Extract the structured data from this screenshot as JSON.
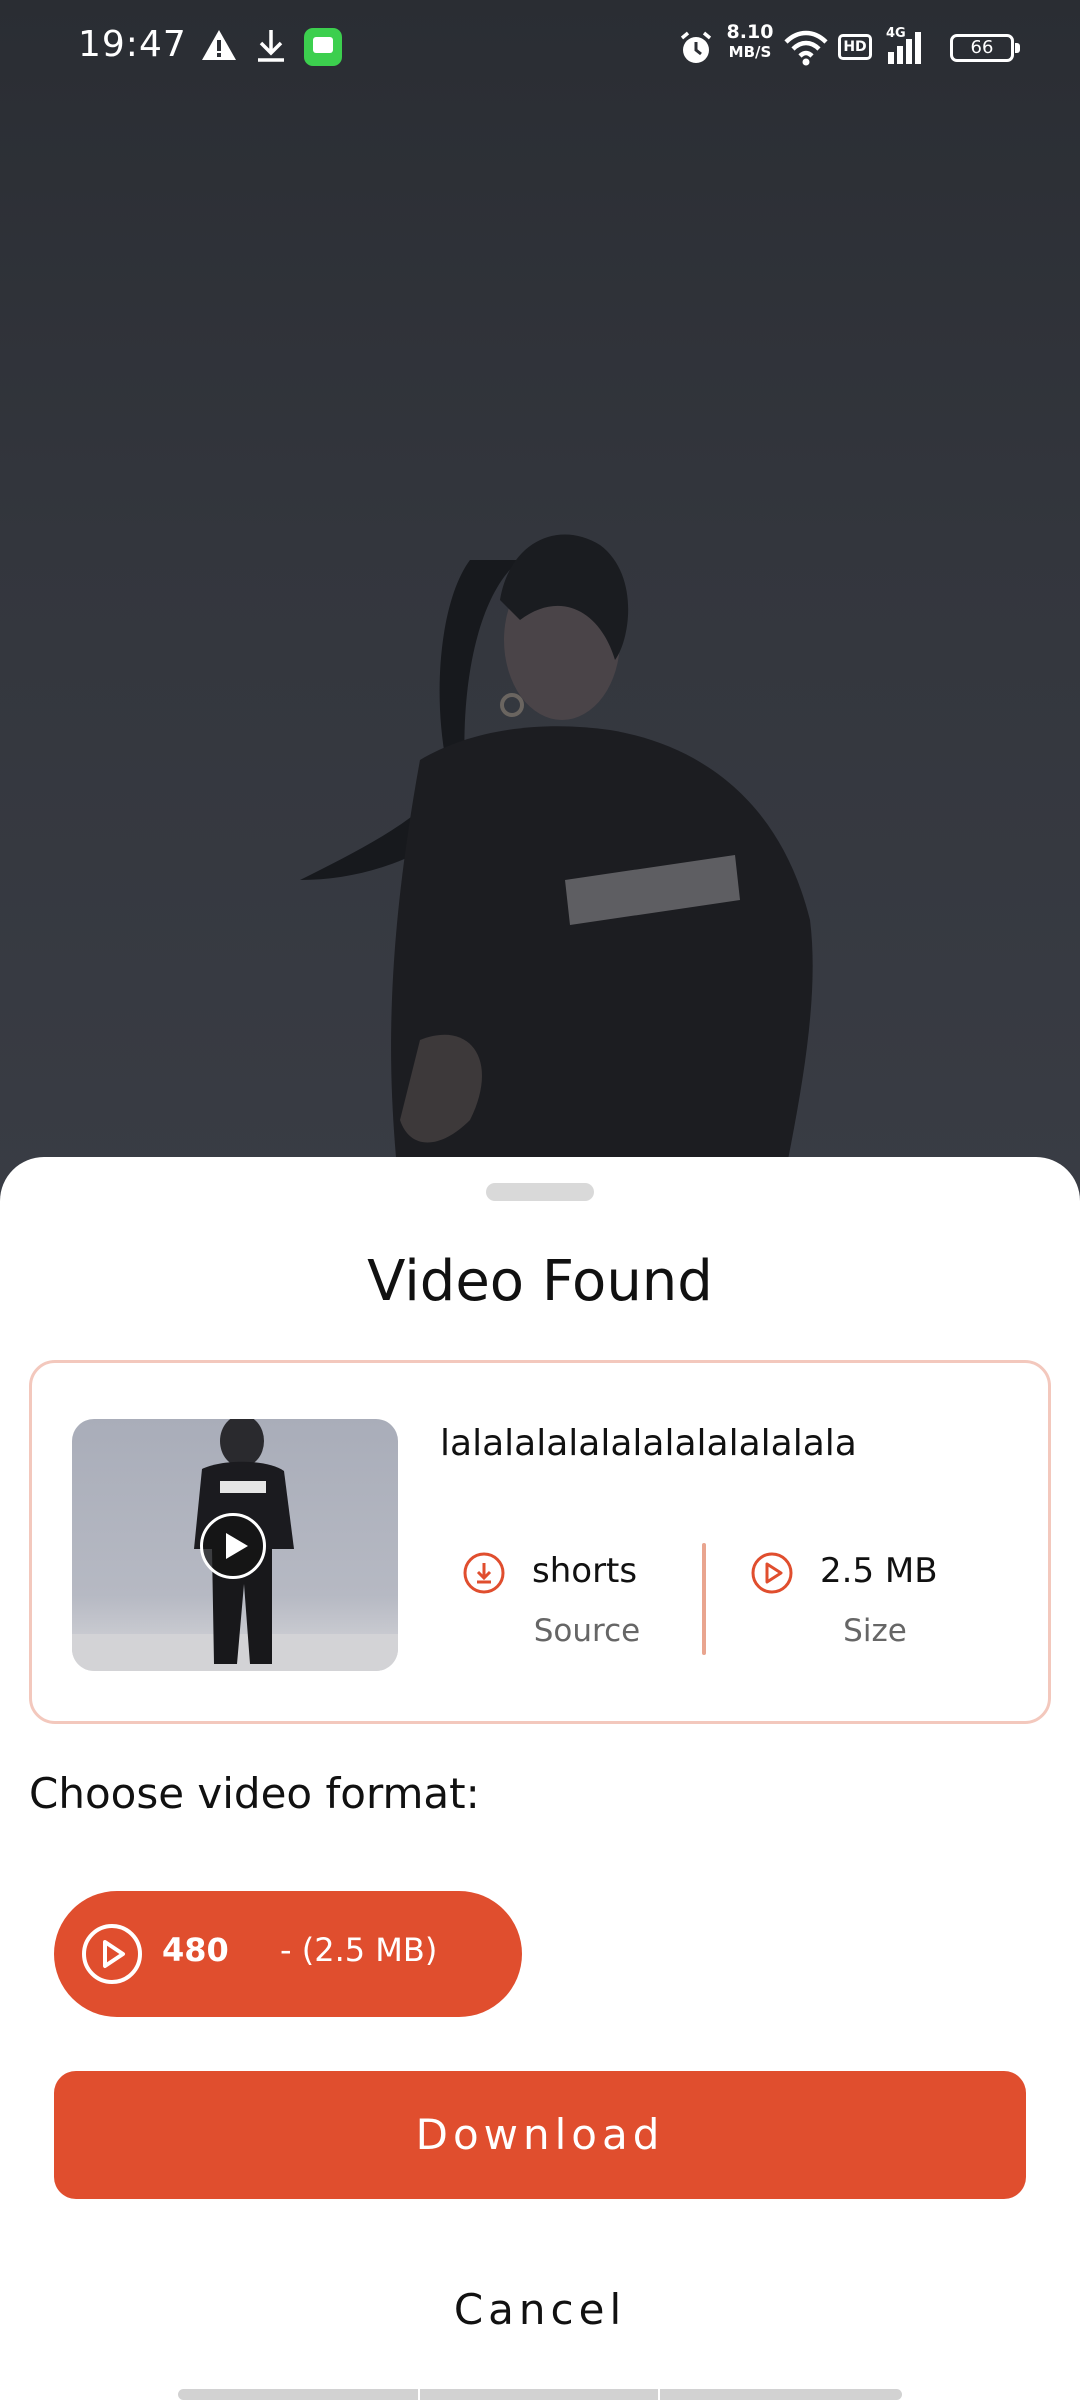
{
  "status_bar": {
    "time": "19:47",
    "net_speed_value": "8.10",
    "net_speed_unit": "MB/S",
    "hd_label": "HD",
    "network_label": "4G",
    "battery_level": "66",
    "icons": [
      "warning-icon",
      "download-arrow-icon",
      "message-app-icon",
      "alarm-icon",
      "wifi-icon",
      "signal-icon",
      "battery-icon"
    ]
  },
  "sheet": {
    "title": "Video Found",
    "video": {
      "title": "lalalalalalalalalalalalala",
      "source_value": "shorts",
      "source_label": "Source",
      "size_value": "2.5 MB",
      "size_label": "Size"
    },
    "choose_format_label": "Choose video format:",
    "formats": [
      {
        "resolution": "480",
        "size_text": "- (2.5 MB)",
        "selected": true
      }
    ],
    "download_label": "Download",
    "cancel_label": "Cancel"
  },
  "colors": {
    "accent": "#e04e2e",
    "card_border": "#f3c8bd",
    "overlay_background": "#2c2f35",
    "sheet_background": "#ffffff"
  }
}
